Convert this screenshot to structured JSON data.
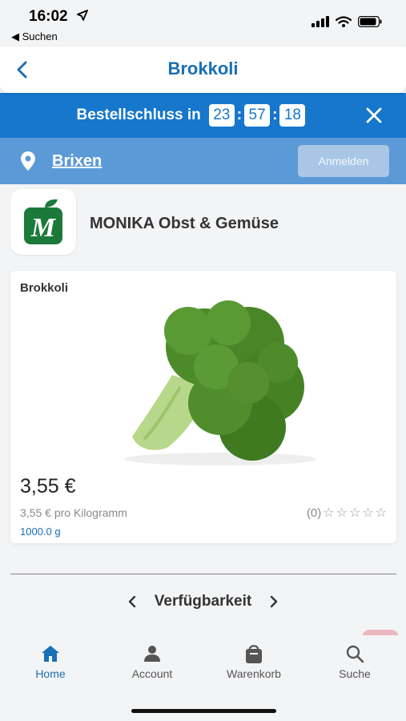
{
  "status_bar": {
    "time": "16:02",
    "back_app": "◀ Suchen"
  },
  "header": {
    "title": "Brokkoli"
  },
  "countdown": {
    "label": "Bestellschluss in",
    "hours": "23",
    "minutes": "57",
    "seconds": "18"
  },
  "location": {
    "city": "Brixen",
    "login_label": "Anmelden"
  },
  "vendor": {
    "name": "MONIKA Obst & Gemüse",
    "logo_letter": "M"
  },
  "product": {
    "title": "Brokkoli",
    "price": "3,55 €",
    "unit_price": "3,55 € pro Kilogramm",
    "weight": "1000.0 g",
    "rating_count": "(0)",
    "stars": 5
  },
  "availability": {
    "label": "Verfügbarkeit"
  },
  "bottom_nav": {
    "items": [
      {
        "label": "Home",
        "icon": "home-icon",
        "active": true
      },
      {
        "label": "Account",
        "icon": "person-icon",
        "active": false
      },
      {
        "label": "Warenkorb",
        "icon": "bag-icon",
        "active": false
      },
      {
        "label": "Suche",
        "icon": "search-icon",
        "active": false
      }
    ]
  },
  "colors": {
    "primary": "#1677cc",
    "location_bar": "#5b9ad6",
    "title_blue": "#1a6fb5",
    "logo_green": "#1b7a3a"
  }
}
